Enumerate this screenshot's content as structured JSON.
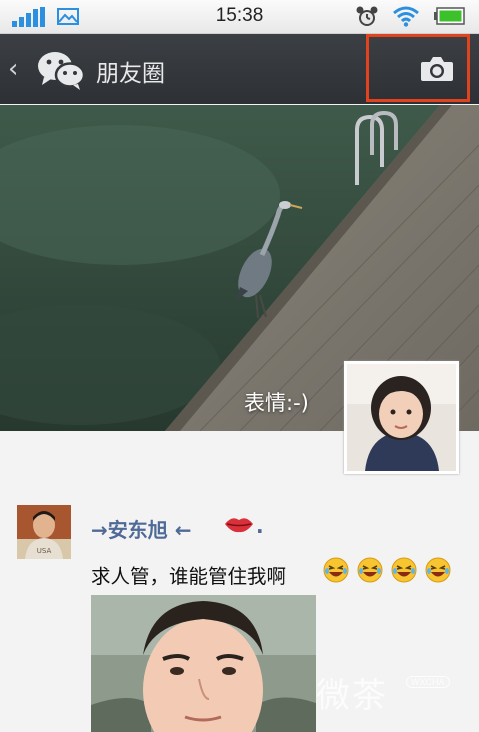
{
  "status_bar": {
    "time": "15:38",
    "icons": [
      "signal-icon",
      "photo-notification-icon",
      "alarm-icon",
      "wifi-icon",
      "battery-icon"
    ],
    "signal_color": "#2d8fe0",
    "battery_color": "#3cc02c"
  },
  "header": {
    "back_icon": "chevron-left-icon",
    "logo_icon": "wechat-logo-icon",
    "title": "朋友圈",
    "camera_icon": "camera-icon",
    "highlight_color": "#e0431e",
    "background": "#33363a"
  },
  "cover": {
    "user_name": "表情:-)",
    "avatar_icon": "profile-avatar"
  },
  "posts": [
    {
      "author": "→安东旭 ←",
      "author_suffix": ".",
      "author_emoji": "lips-icon",
      "text": "求人管，谁能管住我啊",
      "text_emojis": [
        "laugh-emoji",
        "laugh-emoji",
        "laugh-emoji",
        "laugh-emoji"
      ],
      "author_color": "#4f6a97",
      "has_photo": true
    }
  ],
  "watermark": {
    "text": "微茶",
    "sub": "WXCHA"
  }
}
